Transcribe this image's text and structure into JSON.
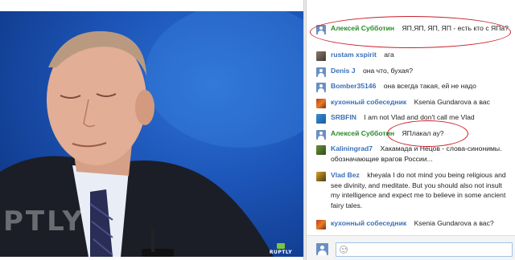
{
  "video": {
    "watermark_big": "PTLY",
    "watermark_small": "RUPTLY"
  },
  "chat": {
    "messages": [
      {
        "author": "Алексей Субботин",
        "author_color": "#2a8a2a",
        "text": "ЯП,ЯП, ЯП, ЯП - есть кто с ЯПа?",
        "avatar": "default-avatar-icon"
      },
      {
        "author": "rustam xspirit",
        "author_color": "#3b6fb8",
        "text": "ага",
        "avatar": "user-photo-avatar"
      },
      {
        "author": "Denis J",
        "author_color": "#3b6fb8",
        "text": "она что, бухая?",
        "avatar": "default-avatar-icon"
      },
      {
        "author": "Bomber35146",
        "author_color": "#3b6fb8",
        "text": "она всегда такая, ей не надо",
        "avatar": "default-avatar-icon"
      },
      {
        "author": "кухонный собеседник",
        "author_color": "#3b6fb8",
        "text": "Ksenia Gundarova а вас",
        "avatar": "user-photo-avatar"
      },
      {
        "author": "SRBFIN",
        "author_color": "#3b6fb8",
        "text": "I am not Vlad and don't call me Vlad",
        "avatar": "user-photo-avatar"
      },
      {
        "author": "Алексей Субботин",
        "author_color": "#2a8a2a",
        "text": "ЯПлакал ау?",
        "avatar": "default-avatar-icon"
      },
      {
        "author": "Kaliningrad7",
        "author_color": "#3b6fb8",
        "text": "Хакамада и Нецов - слова-синонимы. обозначающие врагов России...",
        "avatar": "user-photo-avatar"
      },
      {
        "author": "Vlad Bez",
        "author_color": "#3b6fb8",
        "text": "kheyala I do not mind you being religious and see divinity, and meditate. But you should also not insult my intelligence and expect me to believe in some ancient fairy tales.",
        "avatar": "user-photo-avatar"
      },
      {
        "author": "кухонный собеседник",
        "author_color": "#3b6fb8",
        "text": "Ksenia Gundarova а вас?",
        "avatar": "user-photo-avatar"
      }
    ],
    "input": {
      "placeholder": "",
      "avatar": "default-avatar-icon"
    }
  },
  "colors": {
    "highlight_ring": "#c8202a",
    "link": "#3b6fb8",
    "highlighted_author": "#2a8a2a"
  }
}
